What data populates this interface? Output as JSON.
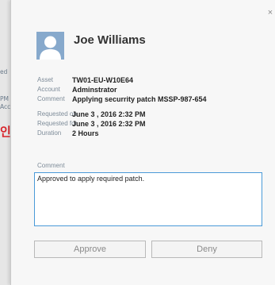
{
  "background": {
    "fragments": [
      "ed",
      "PM",
      "Acc"
    ],
    "korean_text": "인"
  },
  "panel": {
    "close_glyph": "×",
    "user_name": "Joe Williams",
    "details": [
      {
        "label": "Asset",
        "value": "TW01-EU-W10E64"
      },
      {
        "label": "Account",
        "value": "Adminstrator"
      },
      {
        "label": "Comment",
        "value": "Applying securrity patch MSSP-987-654"
      },
      {
        "label": "Requested on",
        "value": "June  3 , 2016  2:32 PM"
      },
      {
        "label": "Requested for",
        "value": "June  3 , 2016  2:32 PM"
      },
      {
        "label": "Duration",
        "value": "2 Hours"
      }
    ],
    "comment_label": "Comment",
    "comment_value": "Approved to apply required patch.",
    "approve_label": "Approve",
    "deny_label": "Deny"
  },
  "colors": {
    "accent": "#4a9ad8",
    "avatar_bg": "#87a9cc",
    "korean_text": "#d9232a"
  },
  "icons": {
    "avatar": "person-silhouette-icon",
    "close": "close-icon"
  }
}
